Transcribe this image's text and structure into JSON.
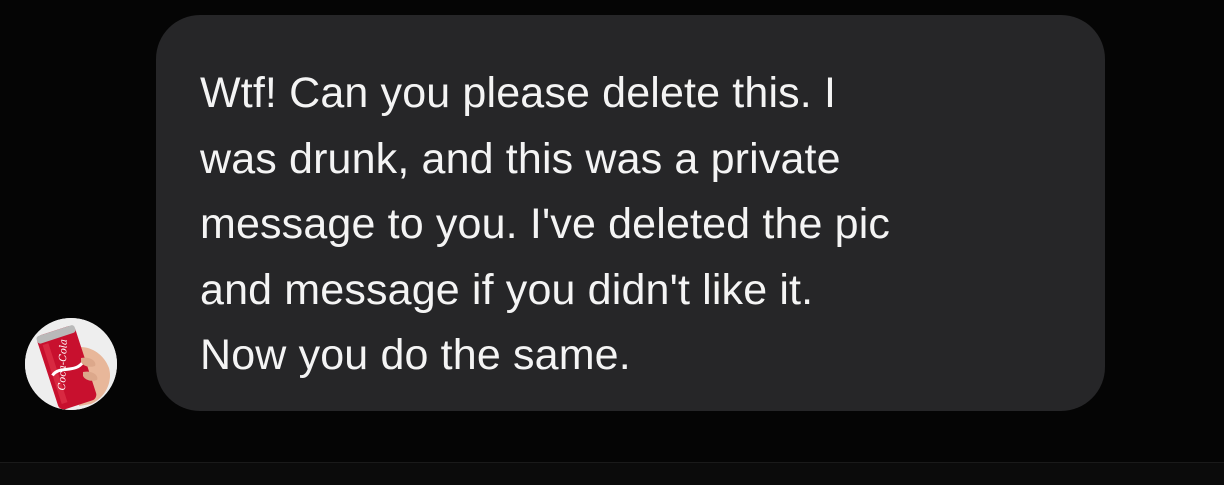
{
  "conversation": {
    "incoming_message": {
      "sender_avatar_icon": "coke-can-avatar-icon",
      "lines": [
        "Wtf! Can you please delete this. I",
        "was drunk, and this was a private",
        "message to you. I've deleted the pic",
        "and message if you didn't like it.",
        "Now you do the same."
      ],
      "avatar_logo_text": "Coca-Cola"
    }
  },
  "colors": {
    "background": "#050505",
    "bubble": "#262628",
    "text": "#f4f4f4",
    "avatar_can_red": "#c8102e"
  }
}
